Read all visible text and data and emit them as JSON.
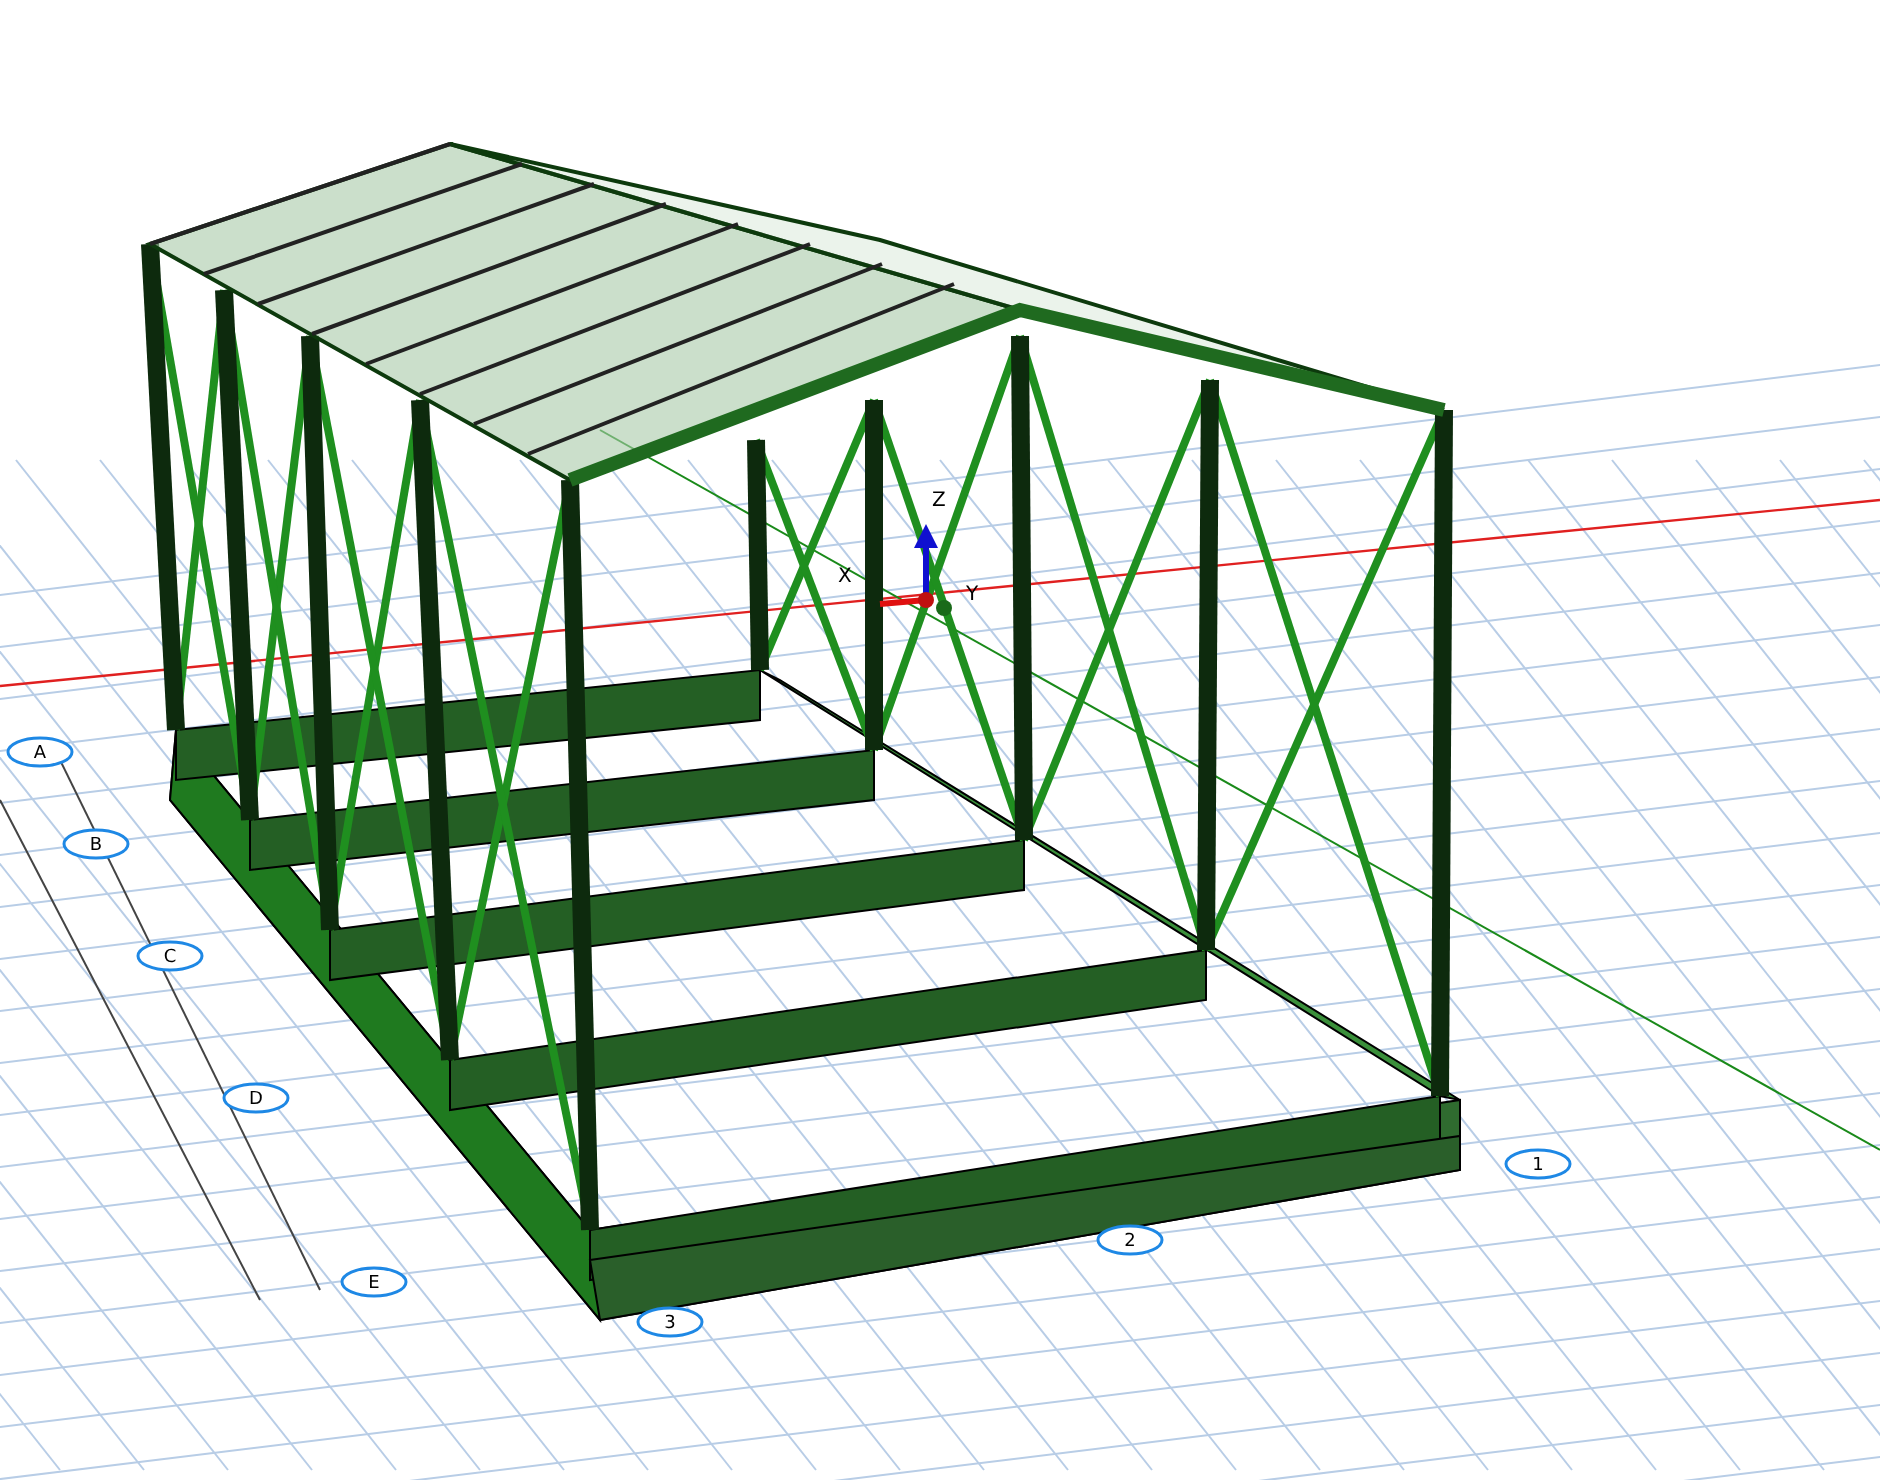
{
  "viewport": {
    "axes": [
      {
        "label": "X"
      },
      {
        "label": "Y"
      },
      {
        "label": "Z"
      }
    ],
    "grid_bubbles": [
      {
        "label": "A"
      },
      {
        "label": "B"
      },
      {
        "label": "C"
      },
      {
        "label": "D"
      },
      {
        "label": "E"
      },
      {
        "label": "1"
      },
      {
        "label": "2"
      },
      {
        "label": "3"
      }
    ]
  }
}
